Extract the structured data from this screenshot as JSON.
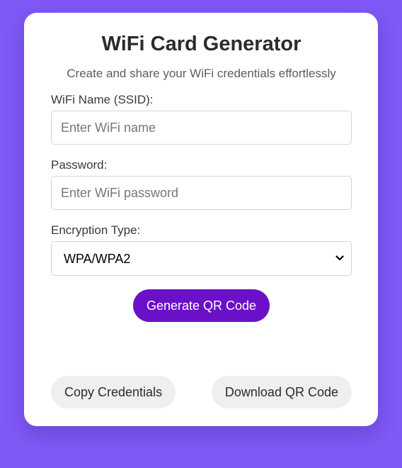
{
  "card": {
    "title": "WiFi Card Generator",
    "subtitle": "Create and share your WiFi credentials effortlessly"
  },
  "form": {
    "ssid": {
      "label": "WiFi Name (SSID):",
      "placeholder": "Enter WiFi name",
      "value": ""
    },
    "password": {
      "label": "Password:",
      "placeholder": "Enter WiFi password",
      "value": ""
    },
    "encryption": {
      "label": "Encryption Type:",
      "selected": "WPA/WPA2"
    }
  },
  "buttons": {
    "generate": "Generate QR Code",
    "copy": "Copy Credentials",
    "download": "Download QR Code"
  },
  "icons": {
    "select_chevron": "chevron-down-icon"
  },
  "colors": {
    "background": "#8059f6",
    "card": "#ffffff",
    "primary_button": "#6a10c9",
    "secondary_button": "#efefef",
    "title_text": "#2b2b2b"
  }
}
